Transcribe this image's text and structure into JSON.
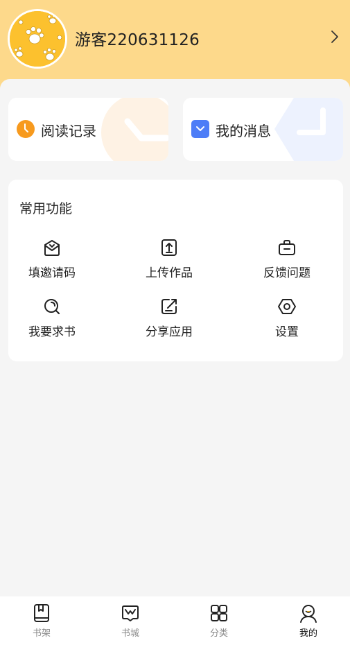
{
  "profile": {
    "username": "游客220631126"
  },
  "quick_cards": [
    {
      "label": "阅读记录",
      "icon": "clock-icon",
      "accent": "#f79a1e"
    },
    {
      "label": "我的消息",
      "icon": "message-icon",
      "accent": "#4d7df7"
    }
  ],
  "functions": {
    "title": "常用功能",
    "items": [
      {
        "label": "填邀请码",
        "icon": "invite-mail-icon"
      },
      {
        "label": "上传作品",
        "icon": "upload-icon"
      },
      {
        "label": "反馈问题",
        "icon": "feedback-bag-icon"
      },
      {
        "label": "我要求书",
        "icon": "search-book-icon"
      },
      {
        "label": "分享应用",
        "icon": "share-icon"
      },
      {
        "label": "设置",
        "icon": "settings-icon"
      }
    ]
  },
  "tabbar": {
    "items": [
      {
        "label": "书架",
        "icon": "bookshelf-icon"
      },
      {
        "label": "书城",
        "icon": "bookstore-icon"
      },
      {
        "label": "分类",
        "icon": "category-grid-icon"
      },
      {
        "label": "我的",
        "icon": "profile-icon"
      }
    ],
    "active_index": 3
  },
  "colors": {
    "header_bg": "#fdd98b",
    "page_bg": "#f5f5f5",
    "avatar_bg": "#fcc12e"
  }
}
